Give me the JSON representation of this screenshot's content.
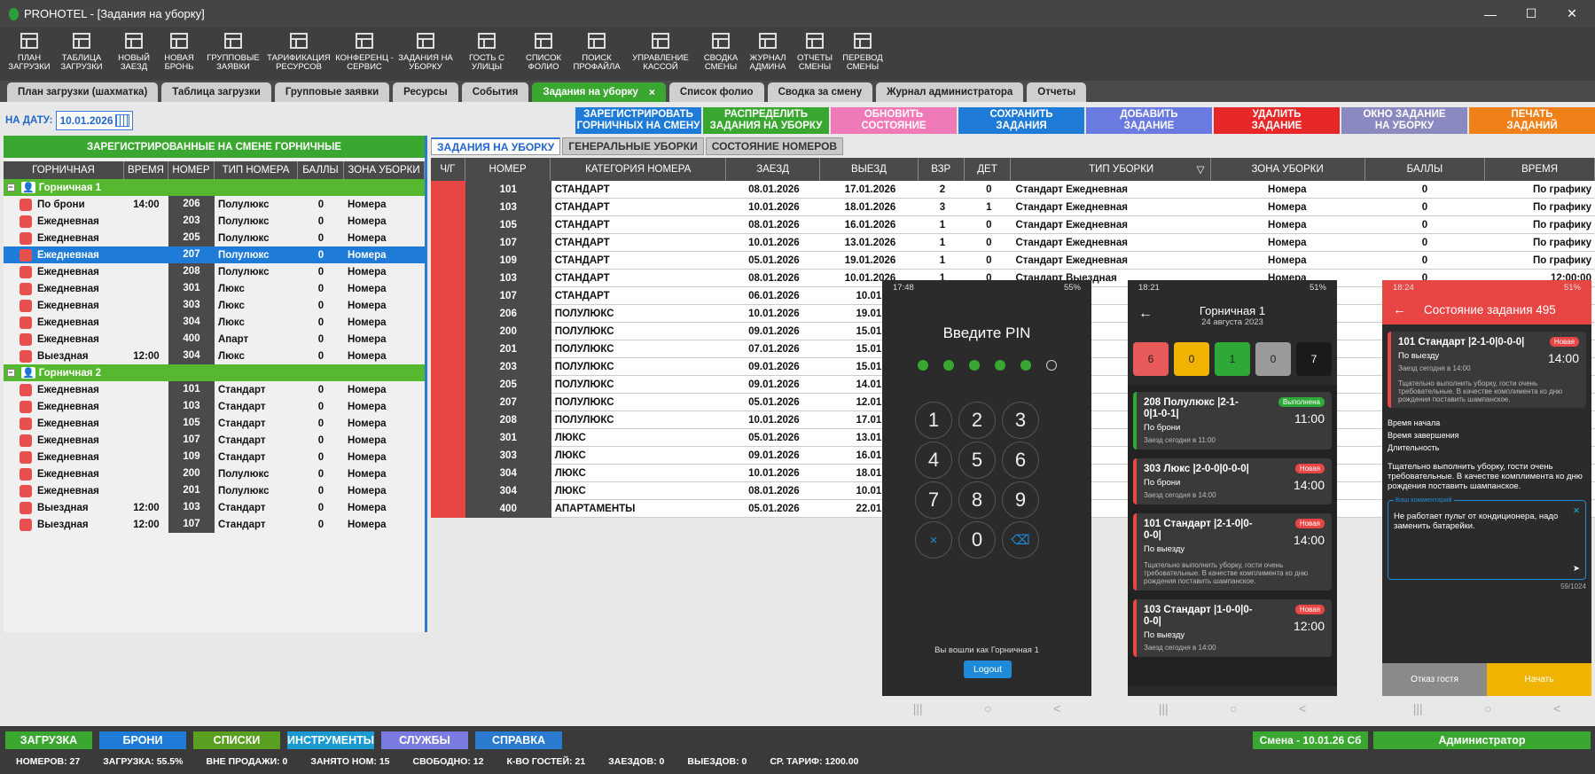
{
  "window": {
    "title": "PROHOTEL - [Задания на уборку]",
    "controls": [
      "—",
      "☐",
      "✕"
    ]
  },
  "toolbar": [
    {
      "icon": "grid-plan-icon",
      "line1": "ПЛАН",
      "line2": "ЗАГРУЗКИ"
    },
    {
      "icon": "table-icon",
      "line1": "ТАБЛИЦА",
      "line2": "ЗАГРУЗКИ"
    },
    {
      "icon": "checkin-icon",
      "line1": "НОВЫЙ",
      "line2": "ЗАЕЗД"
    },
    {
      "icon": "booking-icon",
      "line1": "НОВАЯ",
      "line2": "БРОНЬ"
    },
    {
      "icon": "group-icon",
      "line1": "ГРУППОВЫЕ",
      "line2": "ЗАЯВКИ"
    },
    {
      "icon": "tariff-icon",
      "line1": "ТАРИФИКАЦИЯ",
      "line2": "РЕСУРСОВ"
    },
    {
      "icon": "pie-icon",
      "line1": "КОНФЕРЕНЦ -",
      "line2": "СЕРВИС"
    },
    {
      "icon": "cleaning-icon",
      "line1": "ЗАДАНИЯ НА",
      "line2": "УБОРКУ"
    },
    {
      "icon": "street-guest-icon",
      "line1": "ГОСТЬ С",
      "line2": "УЛИЦЫ"
    },
    {
      "icon": "folio-icon",
      "line1": "СПИСОК",
      "line2": "ФОЛИО"
    },
    {
      "icon": "search-profile-icon",
      "line1": "ПОИСК",
      "line2": "ПРОФАЙЛА"
    },
    {
      "icon": "cashbox-icon",
      "line1": "УПРАВЛЕНИЕ",
      "line2": "КАССОЙ"
    },
    {
      "icon": "shift-summary-icon",
      "line1": "СВОДКА",
      "line2": "СМЕНЫ"
    },
    {
      "icon": "admin-journal-icon",
      "line1": "ЖУРНАЛ",
      "line2": "АДМИНА"
    },
    {
      "icon": "reports-icon",
      "line1": "ОТЧЕТЫ",
      "line2": "СМЕНЫ"
    },
    {
      "icon": "shift-transfer-icon",
      "line1": "ПЕРЕВОД",
      "line2": "СМЕНЫ"
    }
  ],
  "tabs": [
    {
      "label": "План загрузки (шахматка)",
      "active": false
    },
    {
      "label": "Таблица загрузки",
      "active": false
    },
    {
      "label": "Групповые заявки",
      "active": false
    },
    {
      "label": "Ресурсы",
      "active": false
    },
    {
      "label": "События",
      "active": false
    },
    {
      "label": "Задания на уборку",
      "active": true,
      "close": "×"
    },
    {
      "label": "Список фолио",
      "active": false
    },
    {
      "label": "Сводка за смену",
      "active": false
    },
    {
      "label": "Журнал администратора",
      "active": false
    },
    {
      "label": "Отчеты",
      "active": false
    }
  ],
  "date": {
    "label": "НА ДАТУ:",
    "value": "10.01.2026"
  },
  "actions": [
    {
      "l1": "ЗАРЕГИСТРИРОВАТЬ",
      "l2": "ГОРНИЧНЫХ НА СМЕНУ",
      "color": "#1e7bd8"
    },
    {
      "l1": "РАСПРЕДЕЛИТЬ",
      "l2": "ЗАДАНИЯ НА УБОРКУ",
      "color": "#3aa830"
    },
    {
      "l1": "ОБНОВИТЬ",
      "l2": "СОСТОЯНИЕ",
      "color": "#f07ab8"
    },
    {
      "l1": "СОХРАНИТЬ",
      "l2": "ЗАДАНИЯ",
      "color": "#1e7bd8"
    },
    {
      "l1": "ДОБАВИТЬ",
      "l2": "ЗАДАНИЕ",
      "color": "#6a7ae0"
    },
    {
      "l1": "УДАЛИТЬ",
      "l2": "ЗАДАНИЕ",
      "color": "#e82828"
    },
    {
      "l1": "ОКНО ЗАДАНИЕ",
      "l2": "НА УБОРКУ",
      "color": "#8a8ac0"
    },
    {
      "l1": "ПЕЧАТЬ",
      "l2": "ЗАДАНИЙ",
      "color": "#f08018"
    }
  ],
  "left": {
    "header": "ЗАРЕГИСТРИРОВАННЫЕ НА СМЕНЕ ГОРНИЧНЫЕ",
    "columns": [
      "ГОРНИЧНАЯ",
      "ВРЕМЯ",
      "НОМЕР",
      "ТИП НОМЕРА",
      "БАЛЛЫ",
      "ЗОНА УБОРКИ"
    ],
    "groups": [
      {
        "name": "Горничная 1",
        "expander": "−",
        "rows": [
          {
            "name": "По брони",
            "time": "14:00",
            "num": "206",
            "type": "Полулюкс",
            "score": "0",
            "zone": "Номера"
          },
          {
            "name": "Ежедневная",
            "time": "",
            "num": "203",
            "type": "Полулюкс",
            "score": "0",
            "zone": "Номера"
          },
          {
            "name": "Ежедневная",
            "time": "",
            "num": "205",
            "type": "Полулюкс",
            "score": "0",
            "zone": "Номера"
          },
          {
            "name": "Ежедневная",
            "time": "",
            "num": "207",
            "type": "Полулюкс",
            "score": "0",
            "zone": "Номера",
            "selected": true
          },
          {
            "name": "Ежедневная",
            "time": "",
            "num": "208",
            "type": "Полулюкс",
            "score": "0",
            "zone": "Номера"
          },
          {
            "name": "Ежедневная",
            "time": "",
            "num": "301",
            "type": "Люкс",
            "score": "0",
            "zone": "Номера"
          },
          {
            "name": "Ежедневная",
            "time": "",
            "num": "303",
            "type": "Люкс",
            "score": "0",
            "zone": "Номера"
          },
          {
            "name": "Ежедневная",
            "time": "",
            "num": "304",
            "type": "Люкс",
            "score": "0",
            "zone": "Номера"
          },
          {
            "name": "Ежедневная",
            "time": "",
            "num": "400",
            "type": "Апарт",
            "score": "0",
            "zone": "Номера"
          },
          {
            "name": "Выездная",
            "time": "12:00",
            "num": "304",
            "type": "Люкс",
            "score": "0",
            "zone": "Номера"
          }
        ]
      },
      {
        "name": "Горничная 2",
        "expander": "−",
        "rows": [
          {
            "name": "Ежедневная",
            "time": "",
            "num": "101",
            "type": "Стандарт",
            "score": "0",
            "zone": "Номера"
          },
          {
            "name": "Ежедневная",
            "time": "",
            "num": "103",
            "type": "Стандарт",
            "score": "0",
            "zone": "Номера"
          },
          {
            "name": "Ежедневная",
            "time": "",
            "num": "105",
            "type": "Стандарт",
            "score": "0",
            "zone": "Номера"
          },
          {
            "name": "Ежедневная",
            "time": "",
            "num": "107",
            "type": "Стандарт",
            "score": "0",
            "zone": "Номера"
          },
          {
            "name": "Ежедневная",
            "time": "",
            "num": "109",
            "type": "Стандарт",
            "score": "0",
            "zone": "Номера"
          },
          {
            "name": "Ежедневная",
            "time": "",
            "num": "200",
            "type": "Полулюкс",
            "score": "0",
            "zone": "Номера"
          },
          {
            "name": "Ежедневная",
            "time": "",
            "num": "201",
            "type": "Полулюкс",
            "score": "0",
            "zone": "Номера"
          },
          {
            "name": "Выездная",
            "time": "12:00",
            "num": "103",
            "type": "Стандарт",
            "score": "0",
            "zone": "Номера"
          },
          {
            "name": "Выездная",
            "time": "12:00",
            "num": "107",
            "type": "Стандарт",
            "score": "0",
            "zone": "Номера"
          }
        ]
      }
    ]
  },
  "right": {
    "tabs": [
      "ЗАДАНИЯ НА УБОРКУ",
      "ГЕНЕРАЛЬНЫЕ УБОРКИ",
      "СОСТОЯНИЕ НОМЕРОВ"
    ],
    "columns": [
      "Ч/Г",
      "НОМЕР",
      "КАТЕГОРИЯ НОМЕРА",
      "ЗАЕЗД",
      "ВЫЕЗД",
      "ВЗР",
      "ДЕТ",
      "ТИП УБОРКИ",
      "ЗОНА УБОРКИ",
      "БАЛЛЫ",
      "ВРЕМЯ"
    ],
    "filter_glyph": "▽",
    "rows": [
      {
        "num": "101",
        "cat": "СТАНДАРТ",
        "in": "08.01.2026",
        "out": "17.01.2026",
        "vzr": "2",
        "det": "0",
        "ct": "Стандарт Ежедневная",
        "rz": "Номера",
        "rb": "0",
        "time": "По графику"
      },
      {
        "num": "103",
        "cat": "СТАНДАРТ",
        "in": "10.01.2026",
        "out": "18.01.2026",
        "vzr": "3",
        "det": "1",
        "ct": "Стандарт Ежедневная",
        "rz": "Номера",
        "rb": "0",
        "time": "По графику"
      },
      {
        "num": "105",
        "cat": "СТАНДАРТ",
        "in": "08.01.2026",
        "out": "16.01.2026",
        "vzr": "1",
        "det": "0",
        "ct": "Стандарт Ежедневная",
        "rz": "Номера",
        "rb": "0",
        "time": "По графику"
      },
      {
        "num": "107",
        "cat": "СТАНДАРТ",
        "in": "10.01.2026",
        "out": "13.01.2026",
        "vzr": "1",
        "det": "0",
        "ct": "Стандарт Ежедневная",
        "rz": "Номера",
        "rb": "0",
        "time": "По графику"
      },
      {
        "num": "109",
        "cat": "СТАНДАРТ",
        "in": "05.01.2026",
        "out": "19.01.2026",
        "vzr": "1",
        "det": "0",
        "ct": "Стандарт Ежедневная",
        "rz": "Номера",
        "rb": "0",
        "time": "По графику"
      },
      {
        "num": "103",
        "cat": "СТАНДАРТ",
        "in": "08.01.2026",
        "out": "10.01.2026",
        "vzr": "1",
        "det": "0",
        "ct": "Стандарт Выездная",
        "rz": "Номера",
        "rb": "0",
        "time": "12:00:00"
      },
      {
        "num": "107",
        "cat": "СТАНДАРТ",
        "in": "06.01.2026",
        "out": "10.01.",
        "vzr": "",
        "det": "",
        "ct": "",
        "rz": "",
        "rb": "",
        "time": ""
      },
      {
        "num": "206",
        "cat": "ПОЛУЛЮКС",
        "in": "10.01.2026",
        "out": "19.01.",
        "vzr": "",
        "det": "",
        "ct": "",
        "rz": "",
        "rb": "",
        "time": ""
      },
      {
        "num": "200",
        "cat": "ПОЛУЛЮКС",
        "in": "09.01.2026",
        "out": "15.01.",
        "vzr": "",
        "det": "",
        "ct": "",
        "rz": "",
        "rb": "",
        "time": ""
      },
      {
        "num": "201",
        "cat": "ПОЛУЛЮКС",
        "in": "07.01.2026",
        "out": "15.01.",
        "vzr": "",
        "det": "",
        "ct": "",
        "rz": "",
        "rb": "",
        "time": ""
      },
      {
        "num": "203",
        "cat": "ПОЛУЛЮКС",
        "in": "09.01.2026",
        "out": "15.01.",
        "vzr": "",
        "det": "",
        "ct": "",
        "rz": "",
        "rb": "",
        "time": ""
      },
      {
        "num": "205",
        "cat": "ПОЛУЛЮКС",
        "in": "09.01.2026",
        "out": "14.01.",
        "vzr": "",
        "det": "",
        "ct": "",
        "rz": "",
        "rb": "",
        "time": ""
      },
      {
        "num": "207",
        "cat": "ПОЛУЛЮКС",
        "in": "05.01.2026",
        "out": "12.01.",
        "vzr": "",
        "det": "",
        "ct": "",
        "rz": "",
        "rb": "",
        "time": ""
      },
      {
        "num": "208",
        "cat": "ПОЛУЛЮКС",
        "in": "10.01.2026",
        "out": "17.01.",
        "vzr": "",
        "det": "",
        "ct": "",
        "rz": "",
        "rb": "",
        "time": ""
      },
      {
        "num": "301",
        "cat": "ЛЮКС",
        "in": "05.01.2026",
        "out": "13.01.",
        "vzr": "",
        "det": "",
        "ct": "",
        "rz": "",
        "rb": "",
        "time": ""
      },
      {
        "num": "303",
        "cat": "ЛЮКС",
        "in": "09.01.2026",
        "out": "16.01.",
        "vzr": "",
        "det": "",
        "ct": "",
        "rz": "",
        "rb": "",
        "time": ""
      },
      {
        "num": "304",
        "cat": "ЛЮКС",
        "in": "10.01.2026",
        "out": "18.01.",
        "vzr": "",
        "det": "",
        "ct": "",
        "rz": "",
        "rb": "",
        "time": ""
      },
      {
        "num": "304",
        "cat": "ЛЮКС",
        "in": "08.01.2026",
        "out": "10.01.",
        "vzr": "",
        "det": "",
        "ct": "",
        "rz": "",
        "rb": "",
        "time": ""
      },
      {
        "num": "400",
        "cat": "АПАРТАМЕНТЫ",
        "in": "05.01.2026",
        "out": "22.01.",
        "vzr": "",
        "det": "",
        "ct": "",
        "rz": "",
        "rb": "",
        "time": ""
      }
    ]
  },
  "phone1": {
    "time": "17:48",
    "battery": "55%",
    "title": "Введите PIN",
    "keys": [
      "1",
      "2",
      "3",
      "4",
      "5",
      "6",
      "7",
      "8",
      "9",
      "×",
      "0",
      "⌫"
    ],
    "footer": "Вы вошли как Горничная 1",
    "logout": "Logout",
    "nav": [
      "|||",
      "○",
      "<"
    ]
  },
  "phone2": {
    "time": "18:21",
    "battery": "51%",
    "back": "←",
    "title": "Горничная 1",
    "subtitle": "24 августа 2023",
    "counters": [
      {
        "v": "6",
        "c": "#e85a5a"
      },
      {
        "v": "0",
        "c": "#f0b400"
      },
      {
        "v": "1",
        "c": "#2ea836"
      },
      {
        "v": "0",
        "c": "#9a9a9a"
      },
      {
        "v": "7",
        "c": "#1a1a1a"
      }
    ],
    "cards": [
      {
        "t": "208 Полулюкс |2-1-0|1-0-1|",
        "s": "По брони",
        "z": "Заезд сегодня в 11:00",
        "badge": "Выполнена",
        "badgeColor": "#2ea836",
        "border": "#2ea836",
        "tm": "11:00",
        "note": ""
      },
      {
        "t": "303 Люкс |2-0-0|0-0-0|",
        "s": "По брони",
        "z": "Заезд сегодня в 14:00",
        "badge": "Новая",
        "badgeColor": "#e84545",
        "border": "#e84545",
        "tm": "14:00",
        "note": ""
      },
      {
        "t": "101 Стандарт |2-1-0|0-0-0|",
        "s": "По выезду",
        "z": "",
        "badge": "Новая",
        "badgeColor": "#e84545",
        "border": "#e84545",
        "tm": "14:00",
        "note": "Тщательно выполнить уборку, гости очень требовательные. В качестве комплимента ко дню рождения поставить шампанское."
      },
      {
        "t": "103 Стандарт |1-0-0|0-0-0|",
        "s": "По выезду",
        "z": "Заезд сегодня в 14:00",
        "badge": "Новая",
        "badgeColor": "#e84545",
        "border": "#e84545",
        "tm": "12:00",
        "note": ""
      }
    ],
    "nav": [
      "|||",
      "○",
      "<"
    ]
  },
  "phone3": {
    "time": "18:24",
    "battery": "51%",
    "back": "←",
    "title": "Состояние задания 495",
    "card": {
      "t": "101 Стандарт |2-1-0|0-0-0|",
      "s": "По выезду",
      "z": "Заезд сегодня в 14:00",
      "badge": "Новая",
      "tm": "14:00",
      "note": "Тщательно выполнить уборку, гости очень требовательные. В качестве комплимента ко дню рождения поставить шампанское."
    },
    "fields": [
      "Время начала",
      "Время завершения",
      "Длительность"
    ],
    "note": "Тщательно выполнить уборку, гости очень требовательные. В качестве комплимента ко дню рождения поставить шампанское.",
    "comment_label": "Ваш комментарий",
    "comment": "Не работает пульт от кондиционера, надо заменить батарейки.",
    "counter": "59/1024",
    "clear": "✕",
    "send": "➤",
    "refuse": "Отказ гостя",
    "start": "Начать",
    "nav": [
      "|||",
      "○",
      "<"
    ]
  },
  "bottom": {
    "nav": [
      {
        "label": "ЗАГРУЗКА",
        "c": "#3aa830"
      },
      {
        "label": "БРОНИ",
        "c": "#1e7bd8"
      },
      {
        "label": "СПИСКИ",
        "c": "#5aa020"
      },
      {
        "label": "ИНСТРУМЕНТЫ",
        "c": "#1a9ad0"
      },
      {
        "label": "СЛУЖБЫ",
        "c": "#7a7ae0"
      },
      {
        "label": "СПРАВКА",
        "c": "#2a7ad0"
      }
    ],
    "shift": "Смена - 10.01.26  Сб",
    "admin": "Администратор",
    "stats": [
      "НОМЕРОВ: 27",
      "ЗАГРУЗКА: 55.5%",
      "ВНЕ ПРОДАЖИ: 0",
      "ЗАНЯТО НОМ: 15",
      "СВОБОДНО: 12",
      "К-ВО ГОСТЕЙ: 21",
      "ЗАЕЗДОВ: 0",
      "ВЫЕЗДОВ: 0",
      "СР. ТАРИФ: 1200.00"
    ]
  }
}
